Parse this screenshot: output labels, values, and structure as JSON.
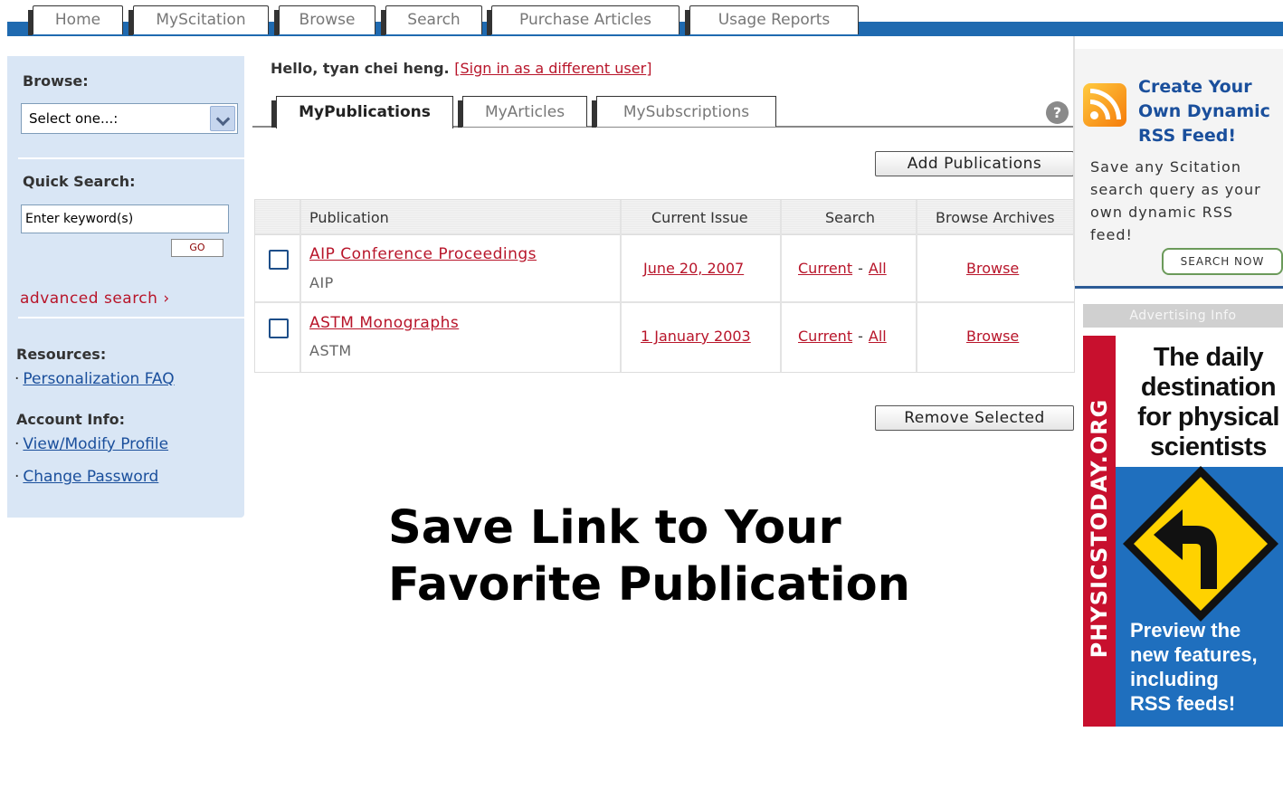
{
  "top_nav": {
    "tabs": [
      "Home",
      "MyScitation",
      "Browse",
      "Search",
      "Purchase Articles",
      "Usage Reports"
    ]
  },
  "sidebar": {
    "browse_heading": "Browse:",
    "browse_select_value": "Select one...:",
    "quick_search_heading": "Quick Search:",
    "quick_search_value": "Enter keyword(s)",
    "go_label": "GO",
    "advanced_search": "advanced search ›",
    "resources_heading": "Resources:",
    "resources_links": [
      "Personalization FAQ"
    ],
    "account_heading": "Account Info:",
    "account_links": [
      "View/Modify Profile",
      "Change Password"
    ]
  },
  "main": {
    "greeting": "Hello, tyan chei heng.",
    "sign_in_link": "Sign in as a different user",
    "tabs": [
      "MyPublications",
      "MyArticles",
      "MySubscriptions"
    ],
    "active_tab": "MyPublications",
    "add_button": "Add Publications",
    "remove_button": "Remove Selected",
    "table": {
      "headers": [
        "Publication",
        "Current Issue",
        "Search",
        "Browse Archives"
      ],
      "rows": [
        {
          "title": "AIP Conference Proceedings",
          "publisher": "AIP",
          "current_issue": "June 20, 2007",
          "search_current": "Current",
          "search_all": "All",
          "browse": "Browse"
        },
        {
          "title": "ASTM Monographs",
          "publisher": "ASTM",
          "current_issue": "1 January 2003",
          "search_current": "Current",
          "search_all": "All",
          "browse": "Browse"
        }
      ]
    },
    "caption": "Save Link to Your\nFavorite Publication"
  },
  "rss_promo": {
    "title": "Create Your\nOwn Dynamic\nRSS Feed!",
    "body": "Save any Scitation\nsearch query as your\nown dynamic RSS\nfeed!",
    "button": "SEARCH NOW",
    "icon": "rss-feed-icon"
  },
  "ad": {
    "advertising_info": "Advertising Info",
    "vertical_text": "PHYSICSTODAY.ORG",
    "headline": "The daily\ndestination\nfor physical\nscientists",
    "preview": "Preview the\nnew features,\nincluding\nRSS feeds!",
    "sign_icon": "left-turn-sign-icon"
  },
  "colors": {
    "brand_blue": "#1f6ab0",
    "link_red": "#b8152a",
    "sidebar_bg": "#d9e6f5"
  }
}
